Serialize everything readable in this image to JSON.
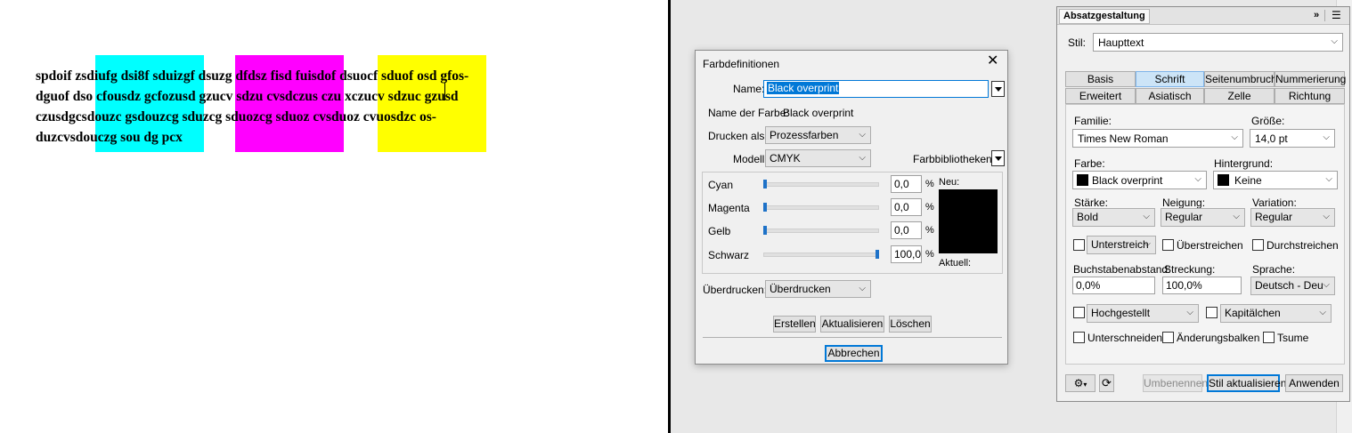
{
  "document": {
    "lines": [
      "spdoif zsdiufg dsi8f sduizgf dsuzg dfdsz fisd fuisdof dsuocf sduof osd gfos-",
      "dguof dso cfousdz gcfozusd gzucv sdzu cvsdczus czu  xczucv sdzuc gzusd",
      "czusdgcsdouzc gsdouzcg sduzcg sduozcg sduoz cvsduoz cvuosdzc os-",
      "duzcvsdouczg sou dg pcx"
    ],
    "swatch_colors": [
      "#00ffff",
      "#ff00ff",
      "#ffff00"
    ]
  },
  "dialog": {
    "title": "Farbdefinitionen",
    "name_label": "Name:",
    "name_value": "Black overprint",
    "color_name_label": "Name der Farbe:",
    "color_name_value": "Black overprint",
    "print_as_label": "Drucken als:",
    "print_as_value": "Prozessfarben",
    "model_label": "Modell:",
    "model_value": "CMYK",
    "libraries_label": "Farbbibliotheken:",
    "channels": [
      {
        "label": "Cyan",
        "value": "0,0",
        "level": 0
      },
      {
        "label": "Magenta",
        "value": "0,0",
        "level": 0
      },
      {
        "label": "Gelb",
        "value": "0,0",
        "level": 0
      },
      {
        "label": "Schwarz",
        "value": "100,0",
        "level": 100
      }
    ],
    "percent": "%",
    "new_label": "Neu:",
    "current_label": "Aktuell:",
    "preview_color": "#000000",
    "overprint_label": "Überdrucken:",
    "overprint_value": "Überdrucken",
    "buttons": {
      "create": "Erstellen",
      "update": "Aktualisieren",
      "delete": "Löschen",
      "cancel": "Abbrechen"
    }
  },
  "panel": {
    "title": "Absatzgestaltung",
    "style_label": "Stil:",
    "style_value": "Haupttext",
    "tabs_row1": [
      "Basis",
      "Schrift",
      "Seitenumbruch",
      "Nummerierung"
    ],
    "tabs_row2": [
      "Erweitert",
      "Asiatisch",
      "Zelle",
      "Richtung"
    ],
    "selected_tab": "Schrift",
    "family_label": "Familie:",
    "family_value": "Times New Roman",
    "size_label": "Größe:",
    "size_value": "14,0 pt",
    "color_label": "Farbe:",
    "color_value": "Black overprint",
    "background_label": "Hintergrund:",
    "background_value": "Keine",
    "weight_label": "Stärke:",
    "weight_value": "Bold",
    "slant_label": "Neigung:",
    "slant_value": "Regular",
    "variation_label": "Variation:",
    "variation_value": "Regular",
    "underline_value": "Unterstreich",
    "overline_label": "Überstreichen",
    "strike_label": "Durchstreichen",
    "tracking_label": "Buchstabenabstand:",
    "tracking_value": "0,0%",
    "stretch_label": "Streckung:",
    "stretch_value": "100,0%",
    "language_label": "Sprache:",
    "language_value": "Deutsch - Deu",
    "position_value": "Hochgestellt",
    "smallcaps_value": "Kapitälchen",
    "kerning_label": "Unterschneiden",
    "changebar_label": "Änderungsbalken",
    "tsume_label": "Tsume",
    "buttons": {
      "rename": "Umbenennen",
      "update_style": "Stil aktualisieren",
      "apply": "Anwenden"
    }
  }
}
